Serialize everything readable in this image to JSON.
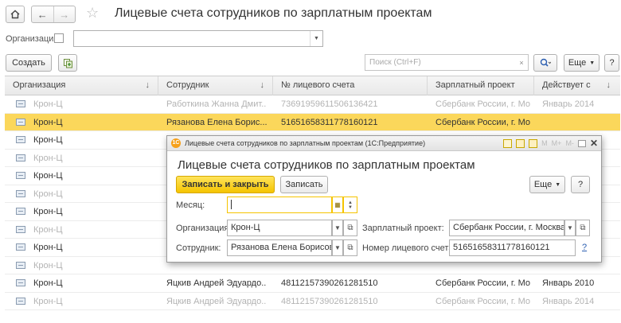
{
  "nav": {
    "home_icon": "home-icon",
    "back_glyph": "←",
    "forward_glyph": "→",
    "star_glyph": "☆",
    "title": "Лицевые счета сотрудников по зарплатным проектам"
  },
  "filter": {
    "org_label": "Организация:",
    "org_value": ""
  },
  "toolbar": {
    "create_label": "Создать",
    "search_placeholder": "Поиск (Ctrl+F)",
    "search_clear": "×",
    "more_label": "Еще",
    "help_label": "?"
  },
  "table": {
    "columns": [
      "Организация",
      "Сотрудник",
      "№ лицевого счета",
      "Зарплатный проект",
      "Действует с"
    ],
    "rows": [
      {
        "org": "Крон-Ц",
        "employee": "Работкина Жанна Дмит...",
        "account": "73691959611506136421",
        "project": "Сбербанк России, г. Мо...",
        "since": "Январь 2014",
        "dim": true,
        "selected": false
      },
      {
        "org": "Крон-Ц",
        "employee": "Рязанова Елена Борис...",
        "account": "51651658311778160121",
        "project": "Сбербанк России, г. Мо...",
        "since": "",
        "dim": false,
        "selected": true
      },
      {
        "org": "Крон-Ц",
        "employee": "",
        "account": "",
        "project": "",
        "since": "",
        "dim": false,
        "selected": false
      },
      {
        "org": "Крон-Ц",
        "employee": "",
        "account": "",
        "project": "",
        "since": "",
        "dim": true,
        "selected": false
      },
      {
        "org": "Крон-Ц",
        "employee": "",
        "account": "",
        "project": "",
        "since": "",
        "dim": false,
        "selected": false
      },
      {
        "org": "Крон-Ц",
        "employee": "",
        "account": "",
        "project": "",
        "since": "",
        "dim": true,
        "selected": false
      },
      {
        "org": "Крон-Ц",
        "employee": "",
        "account": "",
        "project": "",
        "since": "",
        "dim": false,
        "selected": false
      },
      {
        "org": "Крон-Ц",
        "employee": "",
        "account": "",
        "project": "",
        "since": "",
        "dim": true,
        "selected": false
      },
      {
        "org": "Крон-Ц",
        "employee": "",
        "account": "",
        "project": "",
        "since": "",
        "dim": false,
        "selected": false
      },
      {
        "org": "Крон-Ц",
        "employee": "",
        "account": "",
        "project": "",
        "since": "",
        "dim": true,
        "selected": false
      },
      {
        "org": "Крон-Ц",
        "employee": "Яцкив Андрей Эдуардо...",
        "account": "48112157390261281510",
        "project": "Сбербанк России, г. Мо...",
        "since": "Январь 2010",
        "dim": false,
        "selected": false
      },
      {
        "org": "Крон-Ц",
        "employee": "Яцкив Андрей Эдуардо...",
        "account": "48112157390261281510",
        "project": "Сбербанк России, г. Мо...",
        "since": "Январь 2014",
        "dim": true,
        "selected": false
      }
    ]
  },
  "dialog": {
    "window_title": "Лицевые счета сотрудников по зарплатным проектам  (1С:Предприятие)",
    "logo_text": "1С",
    "heading": "Лицевые счета сотрудников по зарплатным проектам",
    "save_close_label": "Записать и закрыть",
    "save_label": "Записать",
    "more_label": "Еще",
    "help_label": "?",
    "month_label": "Месяц:",
    "month_value": "",
    "org_label": "Организация:",
    "org_value": "Крон-Ц",
    "employee_label": "Сотрудник:",
    "employee_value": "Рязанова Елена Борисовн",
    "project_label": "Зарплатный проект:",
    "project_value": "Сбербанк России, г. Москва I",
    "account_label": "Номер лицевого счета:",
    "account_value": "51651658311778160121",
    "account_help": "?",
    "title_icons": [
      "M",
      "M+",
      "M-"
    ]
  },
  "colors": {
    "selected_row": "#fbd75b",
    "primary_button": "#f5c400",
    "dim_text": "#b3b3b3"
  }
}
